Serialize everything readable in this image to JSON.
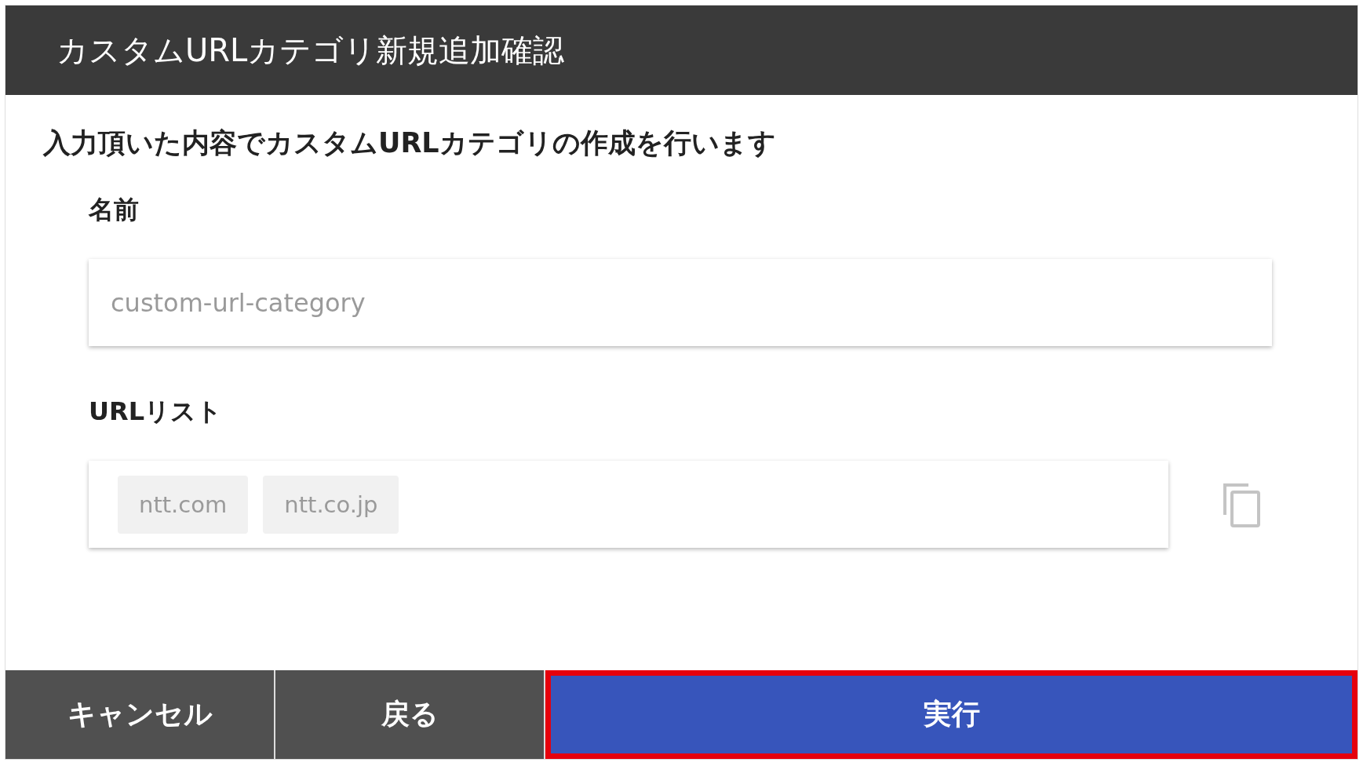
{
  "dialog": {
    "title": "カスタムURLカテゴリ新規追加確認",
    "message": "入力頂いた内容でカスタムURLカテゴリの作成を行います",
    "fields": [
      {
        "label": "名前",
        "kind": "text",
        "value": "custom-url-category"
      },
      {
        "label": "URLリスト",
        "kind": "chips",
        "chips": [
          "ntt.com",
          "ntt.co.jp"
        ]
      }
    ],
    "buttons": [
      {
        "label": "キャンセル",
        "kind": "secondary",
        "highlighted": false
      },
      {
        "label": "戻る",
        "kind": "secondary",
        "highlighted": false
      },
      {
        "label": "実行",
        "kind": "primary",
        "highlighted": true
      }
    ]
  }
}
